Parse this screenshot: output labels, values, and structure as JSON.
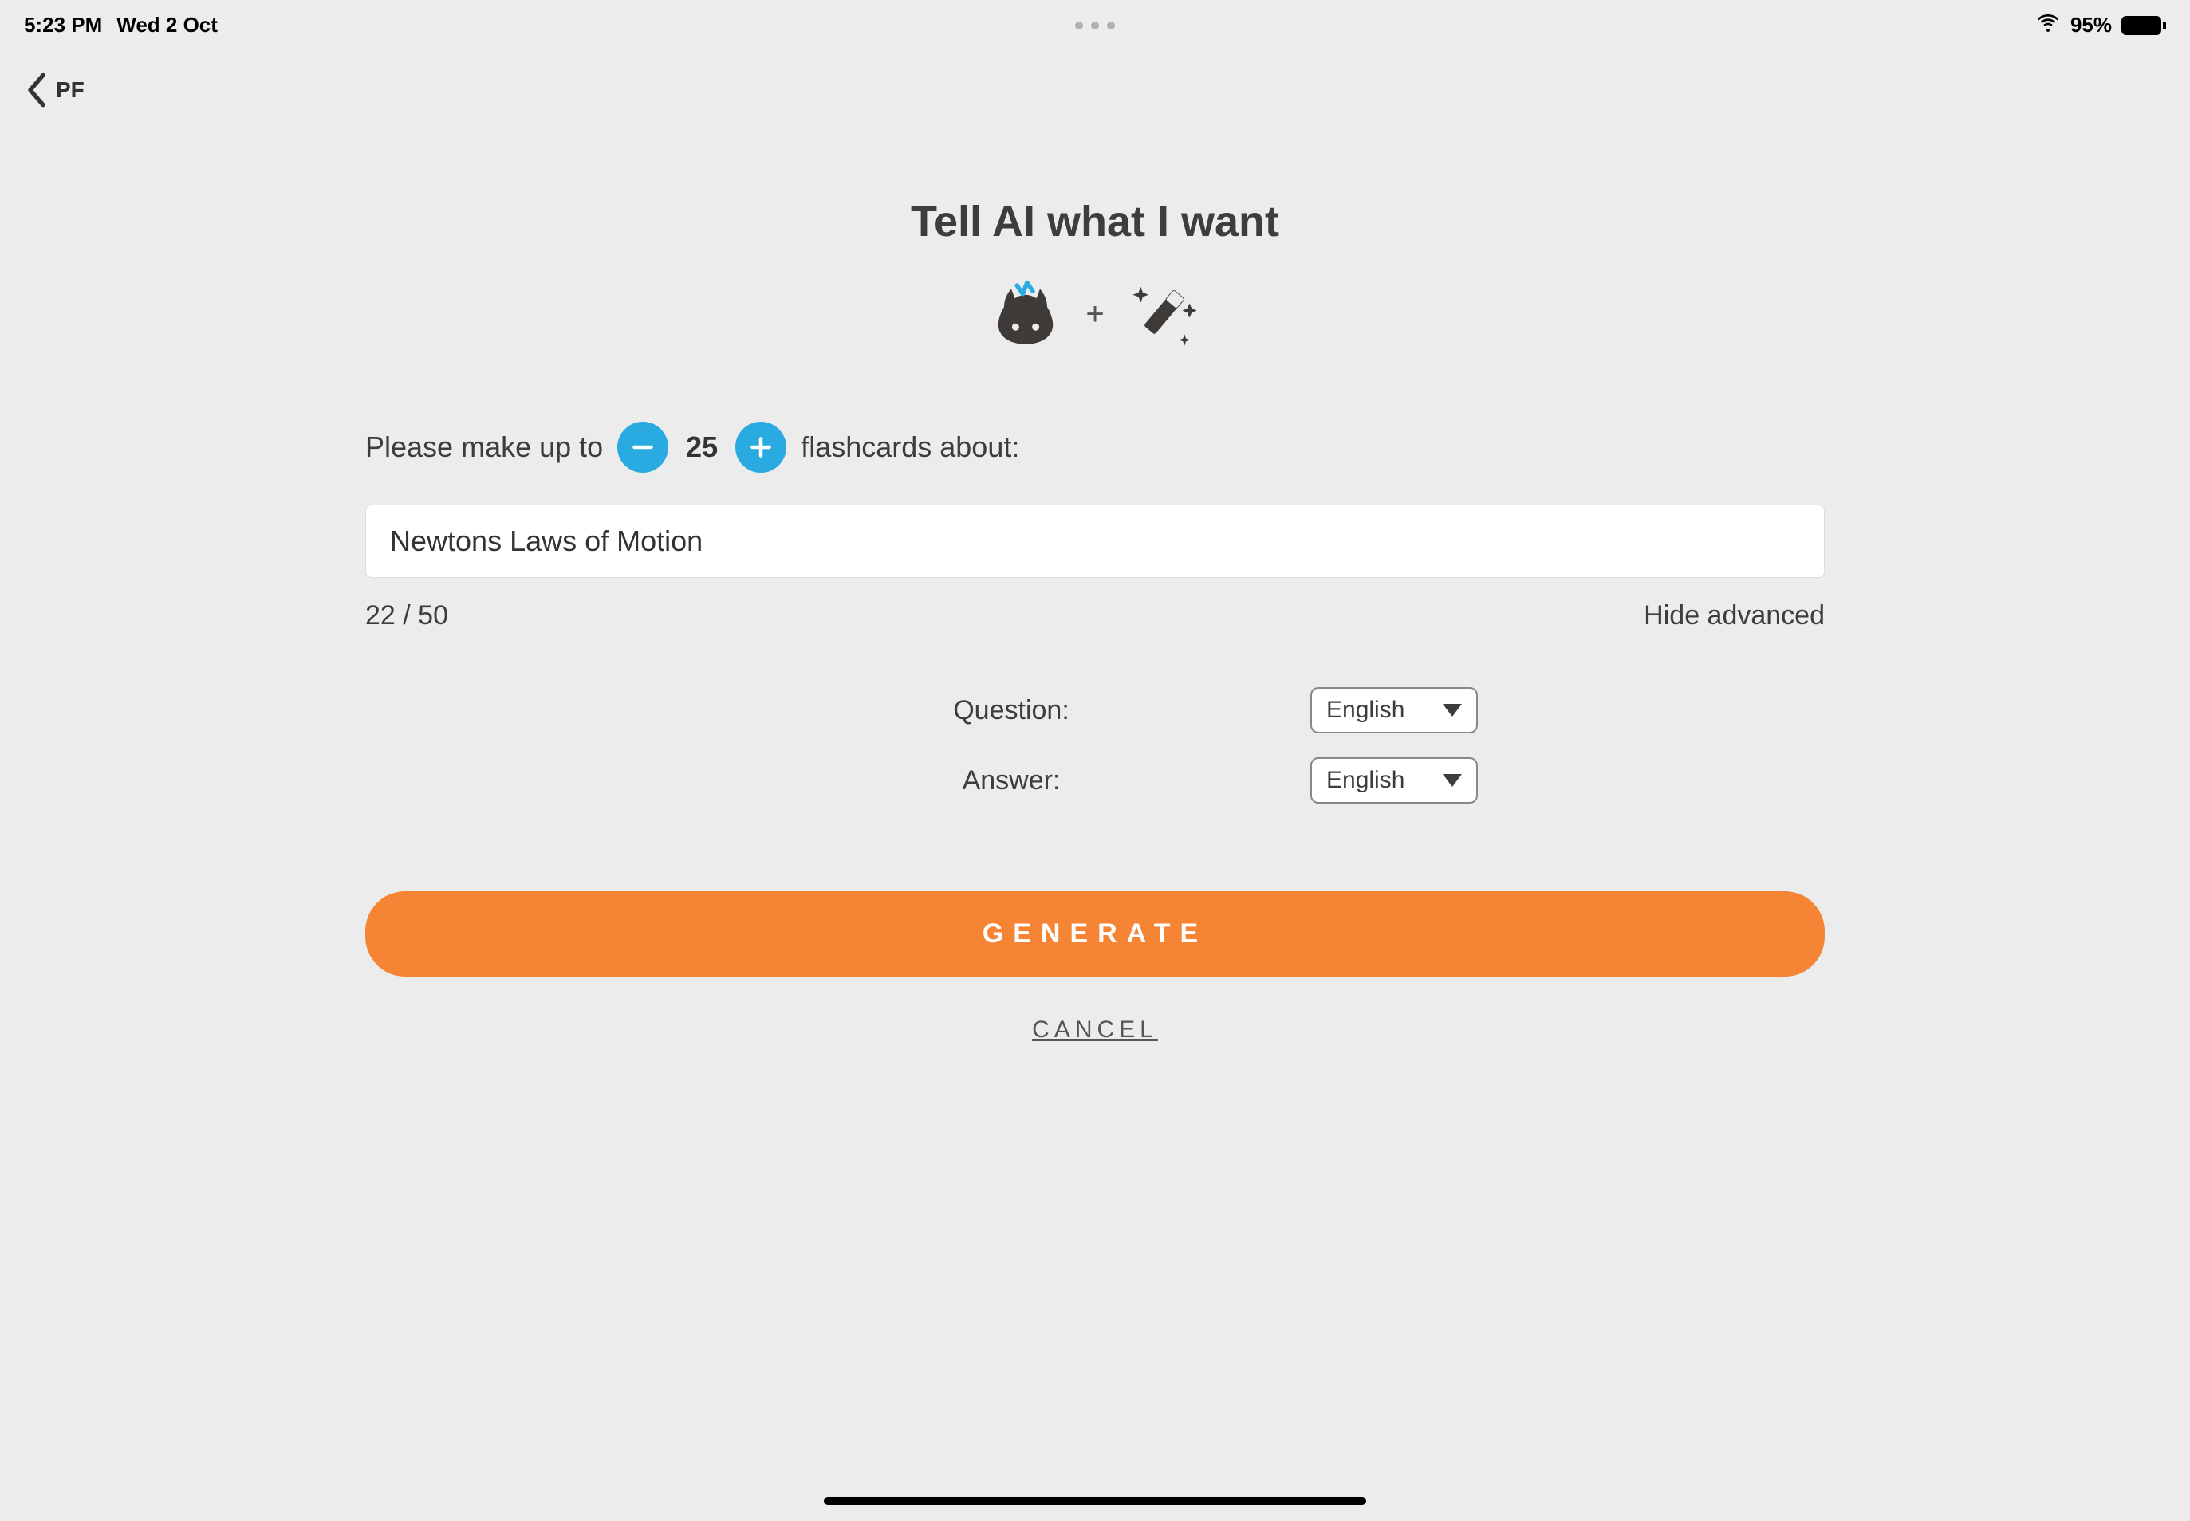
{
  "status": {
    "time": "5:23 PM",
    "date": "Wed 2 Oct",
    "battery_pct": "95%"
  },
  "nav": {
    "back_label": "PF"
  },
  "page": {
    "title": "Tell AI what I want",
    "icon_plus": "+"
  },
  "form": {
    "prefix_text": "Please make up to",
    "count": "25",
    "suffix_text": "flashcards about:",
    "topic_value": "Newtons Laws of Motion",
    "char_counter": "22 / 50",
    "hide_advanced_label": "Hide advanced",
    "question_label": "Question:",
    "answer_label": "Answer:",
    "question_lang": "English",
    "answer_lang": "English",
    "generate_label": "GENERATE",
    "cancel_label": "CANCEL"
  },
  "colors": {
    "accent_blue": "#29abe2",
    "accent_orange": "#f58434",
    "bg": "#ececec"
  }
}
